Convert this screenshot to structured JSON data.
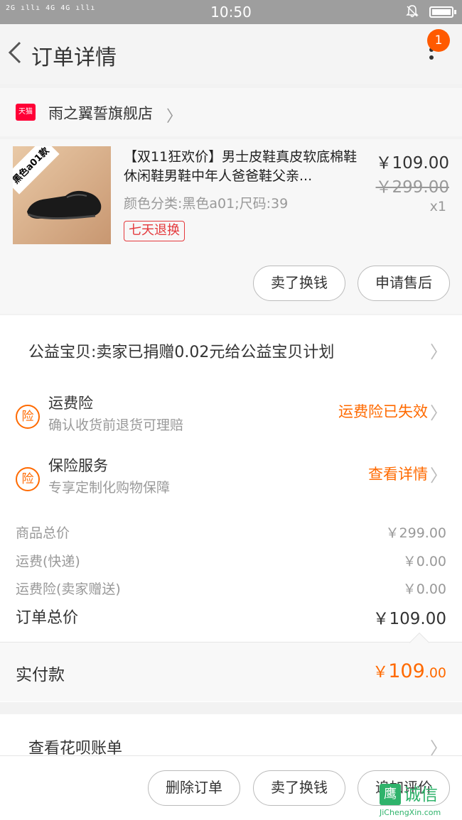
{
  "status_bar": {
    "signal": "2G ıllı 4G 4G ıllı",
    "time": "10:50"
  },
  "nav": {
    "title": "订单详情",
    "badge_count": "1"
  },
  "store": {
    "platform_badge": "天猫",
    "name": "雨之翼誓旗舰店"
  },
  "product": {
    "image_tag": "黑色a01款",
    "title": "【双11狂欢价】男士皮鞋真皮软底棉鞋休闲鞋男鞋中年人爸爸鞋父亲...",
    "sku": "颜色分类:黑色a01;尺码:39",
    "return_policy": "七天退换",
    "price": "￥109.00",
    "original_price": "￥299.00",
    "quantity": "x1",
    "actions": {
      "sell": "卖了换钱",
      "after_sale": "申请售后"
    }
  },
  "charity": {
    "text": "公益宝贝:卖家已捐赠0.02元给公益宝贝计划"
  },
  "insurance": [
    {
      "icon_text": "险",
      "title": "运费险",
      "subtitle": "确认收货前退货可理赔",
      "status": "运费险已失效"
    },
    {
      "icon_text": "险",
      "title": "保险服务",
      "subtitle": "专享定制化购物保障",
      "status": "查看详情"
    }
  ],
  "fees": [
    {
      "label": "商品总价",
      "value": "￥299.00"
    },
    {
      "label": "运费(快递)",
      "value": "￥0.00"
    },
    {
      "label": "运费险(卖家赠送)",
      "value": "￥0.00"
    }
  ],
  "order_total": {
    "label": "订单总价",
    "value": "￥109.00"
  },
  "paid": {
    "label": "实付款",
    "currency": "￥",
    "integer": "109",
    "decimal": ".00"
  },
  "huabei": {
    "label": "查看花呗账单"
  },
  "bottom_actions": {
    "delete": "删除订单",
    "sell": "卖了换钱",
    "review": "追加评价"
  },
  "watermark": {
    "logo": "鹰",
    "text": "诚信",
    "url": "JiChengXin.com"
  },
  "colors": {
    "accent": "#ff6a00",
    "badge": "#ff5a00",
    "tmall": "#ff0036",
    "return_tag": "#e4393c"
  }
}
